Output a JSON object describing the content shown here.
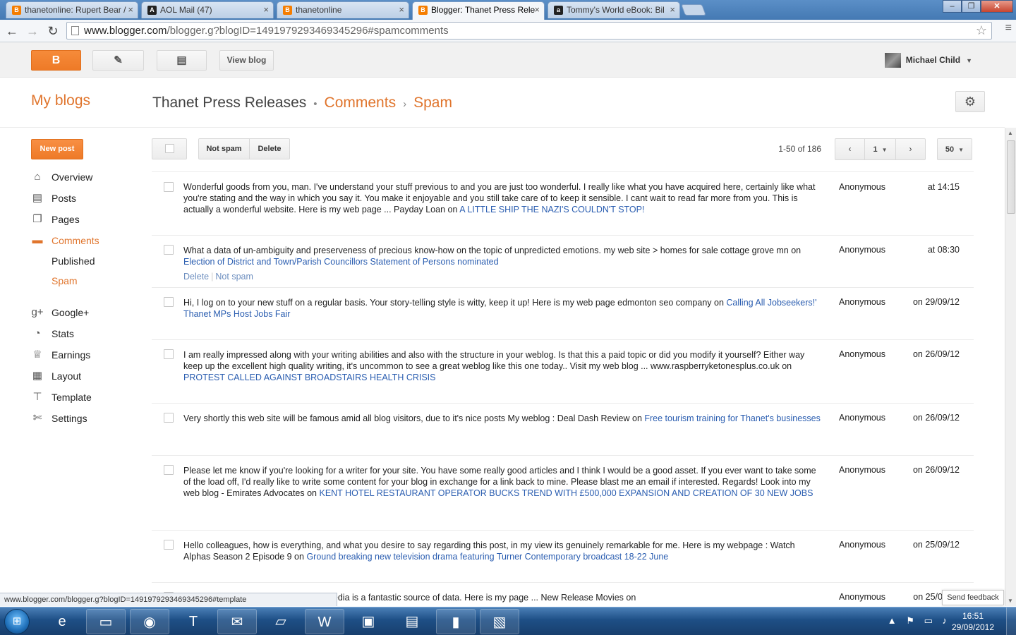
{
  "browser": {
    "tabs": [
      {
        "title": "thanetonline: Rupert Bear /",
        "favicon": "blogger-icon",
        "color": "#f57d00"
      },
      {
        "title": "AOL Mail (47)",
        "favicon": "aol-icon",
        "color": "#222222"
      },
      {
        "title": "thanetonline",
        "favicon": "blogger-icon",
        "color": "#f57d00"
      },
      {
        "title": "Blogger: Thanet Press Rele",
        "favicon": "blogger-icon",
        "color": "#f57d00",
        "active": true
      },
      {
        "title": "Tommy's World eBook: Bil",
        "favicon": "amazon-icon",
        "color": "#222222"
      }
    ],
    "url_host": "www.blogger.com",
    "url_path": "/blogger.g?blogID=1491979293469345296#spamcomments",
    "status_url": "www.blogger.com/blogger.g?blogID=1491979293469345296#template"
  },
  "blogger": {
    "view_blog": "View blog",
    "user_name": "Michael Child",
    "my_blogs": "My blogs",
    "blog_title": "Thanet Press Releases",
    "crumb_comments": "Comments",
    "crumb_spam": "Spam",
    "new_post": "New post",
    "sidebar": [
      {
        "label": "Overview",
        "icon": "home-icon"
      },
      {
        "label": "Posts",
        "icon": "posts-icon"
      },
      {
        "label": "Pages",
        "icon": "pages-icon"
      },
      {
        "label": "Comments",
        "icon": "comments-icon",
        "active": true
      },
      {
        "label": "Published",
        "sub": true
      },
      {
        "label": "Spam",
        "sub": true,
        "active": true
      },
      {
        "label": "Google+",
        "icon": "google-plus-icon"
      },
      {
        "label": "Stats",
        "icon": "stats-icon"
      },
      {
        "label": "Earnings",
        "icon": "trophy-icon"
      },
      {
        "label": "Layout",
        "icon": "layout-icon"
      },
      {
        "label": "Template",
        "icon": "template-icon"
      },
      {
        "label": "Settings",
        "icon": "wrench-icon"
      }
    ],
    "actions": {
      "not_spam": "Not spam",
      "delete": "Delete"
    },
    "pagination": {
      "range": "1-50 of 186",
      "page": "1",
      "per_page": "50"
    },
    "comments": [
      {
        "text": "Wonderful goods from you, man. I've understand your stuff previous to and you are just too wonderful. I really like what you have acquired here, certainly like what you're stating and the way in which you say it. You make it enjoyable and you still take care of to keep it sensible. I cant wait to read far more from you. This is actually a wonderful website. Here is my web page ... Payday Loan on",
        "post": "A LITTLE SHIP THE NAZI'S COULDN'T STOP!",
        "author": "Anonymous",
        "date": "at 14:15"
      },
      {
        "text": "What a data of un-ambiguity and preserveness of precious know-how on the topic of unpredicted emotions. my web site > homes for sale cottage grove mn on",
        "post": "Election of District and Town/Parish Councillors Statement of Persons nominated",
        "author": "Anonymous",
        "date": "at 08:30",
        "row_actions": {
          "delete": "Delete",
          "not_spam": "Not spam"
        }
      },
      {
        "text": "Hi, I log on to your new stuff on a regular basis. Your story-telling style is witty, keep it up! Here is my web page edmonton seo company on",
        "post": "Calling All Jobseekers!' Thanet MPs Host Jobs Fair",
        "author": "Anonymous",
        "date": "on 29/09/12"
      },
      {
        "text": "I am really impressed along with your writing abilities and also with the structure in your weblog. Is that this a paid topic or did you modify it yourself? Either way keep up the excellent high quality writing, it's uncommon to see a great weblog like this one today.. Visit my web blog ... www.raspberryketonesplus.co.uk on",
        "post": "PROTEST CALLED AGAINST BROADSTAIRS HEALTH CRISIS",
        "author": "Anonymous",
        "date": "on 26/09/12"
      },
      {
        "text": "Very shortly this web site will be famous amid all blog visitors, due to it's nice posts My weblog : Deal Dash Review on",
        "post": "Free tourism training for Thanet's businesses",
        "author": "Anonymous",
        "date": "on 26/09/12"
      },
      {
        "text": "Please let me know if you're looking for a writer for your site. You have some really good articles and I think I would be a good asset. If you ever want to take some of the load off, I'd really like to write some content for your blog in exchange for a link back to mine. Please blast me an email if interested. Regards! Look into my web blog - Emirates Advocates on",
        "post": "KENT HOTEL RESTAURANT OPERATOR BUCKS TREND WITH £500,000 EXPANSION AND CREATION OF 30 NEW JOBS",
        "author": "Anonymous",
        "date": "on 26/09/12"
      },
      {
        "text": "Hello colleagues, how is everything, and what you desire to say regarding this post, in my view its genuinely remarkable for me. Here is my webpage : Watch Alphas Season 2 Episode 9 on",
        "post": "Ground breaking new television drama featuring Turner Contemporary broadcast 18-22 June",
        "author": "Anonymous",
        "date": "on 25/09/12"
      },
      {
        "text": "the topic of media print, we all know media is a fantastic source of data. Here is my page ... New Release Movies on",
        "post": "",
        "author": "Anonymous",
        "date": "on 25/0"
      }
    ],
    "send_feedback": "Send feedback"
  },
  "taskbar": {
    "apps": [
      "start-orb-icon",
      "internet-explorer-icon",
      "file-explorer-icon",
      "chrome-icon",
      "tiscali-icon",
      "thunderbird-icon",
      "notepad-icon",
      "word-icon",
      "network-icon",
      "remote-desktop-icon",
      "book-app-icon",
      "media-app-icon"
    ],
    "time": "16:51",
    "date": "29/09/2012"
  }
}
